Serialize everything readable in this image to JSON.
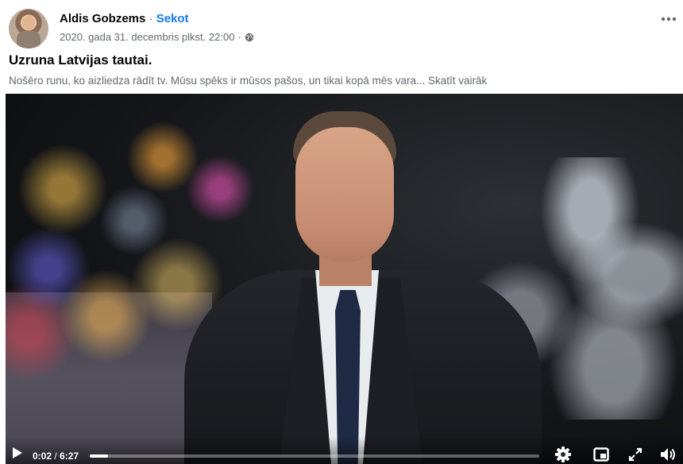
{
  "post": {
    "author_name": "Aldis Gobzems",
    "separator": " · ",
    "follow_label": "Sekot",
    "timestamp": "2020. gada 31. decembris plkst. 22:00",
    "meta_separator": "·",
    "privacy_icon": "globe-icon",
    "more_icon": "more-options-icon",
    "title": "Uzruna Latvijas tautai.",
    "text": "Nošēro runu, ko aizliedza rādīt tv. Mūsu spēks ir mūsos pašos, un tikai kopā mēs vara...",
    "see_more_label": "Skatīt vairāk"
  },
  "video": {
    "current_time": "0:02",
    "time_separator": " / ",
    "duration": "6:27",
    "progress_fraction": 0.005,
    "icons": [
      "play-icon",
      "settings-icon",
      "picture-in-picture-icon",
      "fullscreen-icon",
      "volume-icon"
    ]
  },
  "colors": {
    "link": "#1877f2",
    "secondary_text": "#65676b",
    "primary_text": "#050505"
  }
}
